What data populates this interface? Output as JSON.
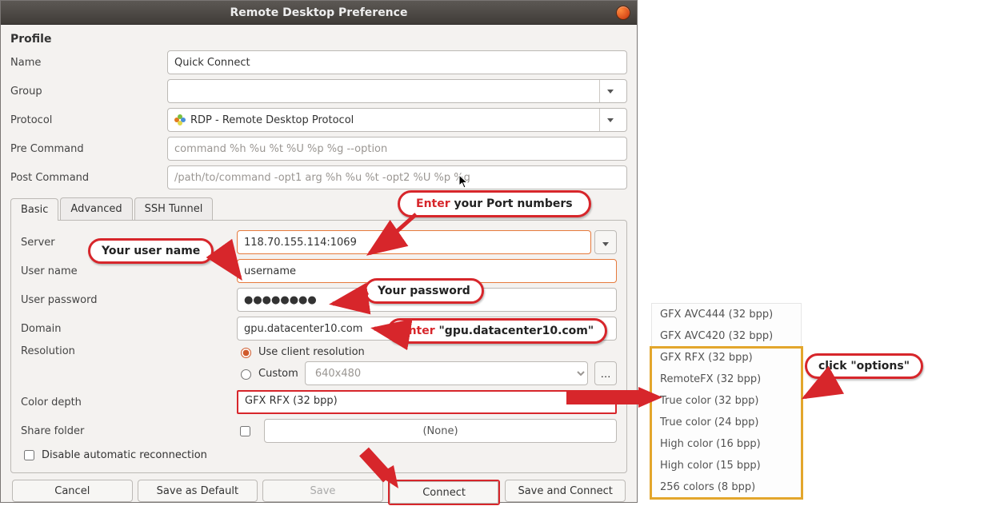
{
  "window": {
    "title": "Remote Desktop Preference"
  },
  "profile": {
    "heading": "Profile",
    "name_label": "Name",
    "name_value": "Quick Connect",
    "group_label": "Group",
    "group_value": "",
    "protocol_label": "Protocol",
    "protocol_value": "RDP - Remote Desktop Protocol",
    "pre_label": "Pre Command",
    "pre_placeholder": "command %h %u %t %U %p %g --option",
    "post_label": "Post Command",
    "post_placeholder": "/path/to/command -opt1 arg %h %u %t -opt2 %U %p %g"
  },
  "tabs": {
    "basic": "Basic",
    "advanced": "Advanced",
    "ssh": "SSH Tunnel"
  },
  "basic": {
    "server_label": "Server",
    "server_value": "118.70.155.114:1069",
    "user_label": "User name",
    "user_value": "username",
    "password_label": "User password",
    "password_value": "●●●●●●●●",
    "domain_label": "Domain",
    "domain_value": "gpu.datacenter10.com",
    "resolution_label": "Resolution",
    "res_client": "Use client resolution",
    "res_custom": "Custom",
    "res_custom_value": "640x480",
    "color_label": "Color depth",
    "color_value": "GFX RFX (32 bpp)",
    "share_label": "Share folder",
    "share_value": "(None)",
    "disable_label": "Disable automatic reconnection"
  },
  "buttons": {
    "cancel": "Cancel",
    "save_default": "Save as Default",
    "save": "Save",
    "connect": "Connect",
    "save_connect": "Save and Connect"
  },
  "color_options": [
    "GFX AVC444 (32 bpp)",
    "GFX AVC420 (32 bpp)",
    "GFX RFX (32 bpp)",
    "RemoteFX (32 bpp)",
    "True color (32 bpp)",
    "True color (24 bpp)",
    "High color (16 bpp)",
    "High color (15 bpp)",
    "256 colors (8 bpp)"
  ],
  "callouts": {
    "port": {
      "red": "Enter",
      "rest": " your Port numbers"
    },
    "user": "Your user name",
    "pass": "Your password",
    "domain": {
      "red": "Enter",
      "rest": " \"gpu.datacenter10.com\""
    },
    "options": "click \"options\""
  },
  "colors": {
    "accent_red": "#d7262b",
    "accent_orange": "#e3a62c"
  }
}
